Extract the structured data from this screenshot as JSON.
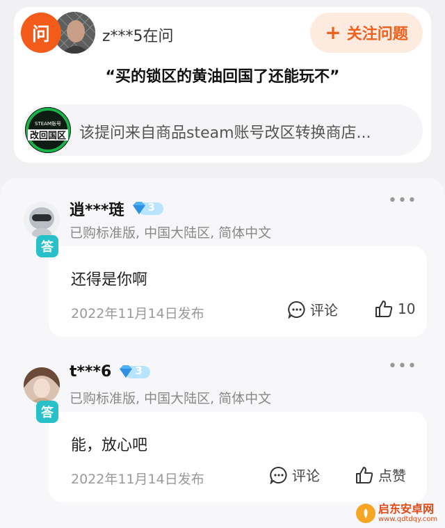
{
  "question_card": {
    "ask_badge": "问",
    "asker_name": "z***5在问",
    "follow_button": "关注问题",
    "question_text": "“买的锁区的黄油回国了还能玩不”",
    "product_text": "该提问来自商品steam账号改区转换商店...",
    "product_thumb_text": "改回国区",
    "product_thumb_small": "STEAM账号"
  },
  "answers": [
    {
      "username": "逍***琏",
      "vip_level": "3",
      "tag": "答",
      "purchase_info": "已购标准版, 中国大陆区, 简体中文",
      "text": "还得是你啊",
      "date": "2022年11月14日发布",
      "comment_label": "评论",
      "like_label": "10"
    },
    {
      "username": "t***6",
      "vip_level": "3",
      "tag": "答",
      "purchase_info": "已购标准版, 中国大陆区, 简体中文",
      "text": "能，放心吧",
      "date": "2022年11月14日发布",
      "comment_label": "评论",
      "like_label": "点赞"
    }
  ],
  "watermark": {
    "name": "启东安卓网",
    "url": "www.qdtdqy.com"
  },
  "colors": {
    "accent_orange": "#f25b1a",
    "answer_tag_teal": "#28c1c9",
    "vip_blue": "#b9e4ff"
  }
}
